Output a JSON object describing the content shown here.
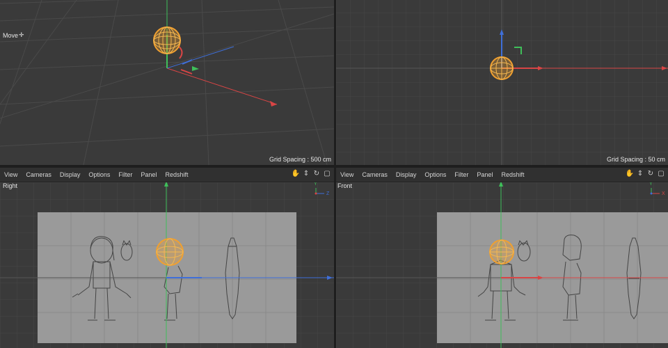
{
  "viewports": {
    "perspective": {
      "mode_label": "Move",
      "grid_spacing": "Grid Spacing : 500 cm"
    },
    "top": {
      "grid_spacing": "Grid Spacing : 50 cm"
    },
    "right": {
      "label": "Right"
    },
    "front": {
      "label": "Front"
    }
  },
  "menu": {
    "items": [
      "View",
      "Cameras",
      "Display",
      "Options",
      "Filter",
      "Panel",
      "Redshift"
    ]
  },
  "axis_labels": {
    "y": "Y",
    "z": "Z",
    "x": "X"
  },
  "icons": [
    "hand-pan-icon",
    "move-arrows-icon",
    "rotate-icon",
    "maximize-icon"
  ],
  "colors": {
    "x_axis": "#d94545",
    "y_axis": "#3fbf5a",
    "z_axis": "#3f6fd9",
    "selection": "#f0a030",
    "grid_bg": "#3a3a3a",
    "plate": "#9a9a9a"
  }
}
